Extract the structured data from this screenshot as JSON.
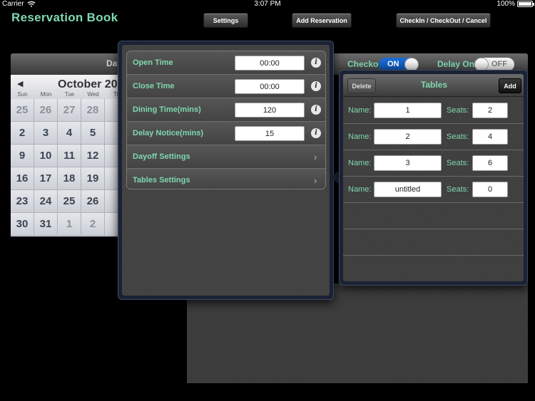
{
  "status_bar": {
    "carrier": "Carrier",
    "time": "3:07 PM",
    "battery": "100%",
    "battery_level": 1.0,
    "icons": [
      "wifi-icon",
      "battery-icon"
    ]
  },
  "nav": {
    "title": "Reservation Book",
    "settings_label": "Settings",
    "add_reservation_label": "Add Reservation",
    "checkin_label": "CheckIn / CheckOut / Cancel"
  },
  "header": {
    "date_label": "Date:",
    "checkout_label": "Checkout",
    "checkout_toggle": "ON",
    "delay_label": "Delay Only",
    "delay_toggle": "OFF"
  },
  "calendar": {
    "prev_icon": "◀",
    "month_label": "October 20",
    "weekdays": [
      "Sun",
      "Mon",
      "Tue",
      "Wed",
      "Th"
    ],
    "weeks": [
      [
        {
          "d": "25",
          "dim": true
        },
        {
          "d": "26",
          "dim": true
        },
        {
          "d": "27",
          "dim": true
        },
        {
          "d": "28",
          "dim": true
        },
        {
          "d": "",
          "dim": true
        }
      ],
      [
        {
          "d": "2"
        },
        {
          "d": "3"
        },
        {
          "d": "4"
        },
        {
          "d": "5"
        },
        {
          "d": ""
        }
      ],
      [
        {
          "d": "9"
        },
        {
          "d": "10"
        },
        {
          "d": "11"
        },
        {
          "d": "12"
        },
        {
          "d": ""
        }
      ],
      [
        {
          "d": "16"
        },
        {
          "d": "17"
        },
        {
          "d": "18"
        },
        {
          "d": "19"
        },
        {
          "d": ""
        }
      ],
      [
        {
          "d": "23"
        },
        {
          "d": "24"
        },
        {
          "d": "25"
        },
        {
          "d": "26"
        },
        {
          "d": ""
        }
      ],
      [
        {
          "d": "30"
        },
        {
          "d": "31"
        },
        {
          "d": "1",
          "dim": true
        },
        {
          "d": "2",
          "dim": true
        },
        {
          "d": ""
        }
      ]
    ]
  },
  "settings": {
    "rows": [
      {
        "label": "Open Time",
        "value": "00:00",
        "icon": "info-icon"
      },
      {
        "label": "Close Time",
        "value": "00:00",
        "icon": "info-icon"
      },
      {
        "label": "Dining Time(mins)",
        "value": "120",
        "icon": "info-icon"
      },
      {
        "label": "Delay Notice(mins)",
        "value": "15",
        "icon": "info-icon"
      },
      {
        "label": "Dayoff Settings",
        "icon": "chevron-right-icon"
      },
      {
        "label": "Tables Settings",
        "icon": "chevron-right-icon"
      }
    ]
  },
  "tables": {
    "title": "Tables",
    "delete_label": "Delete",
    "add_label": "Add",
    "name_label": "Name:",
    "seats_label": "Seats:",
    "rows": [
      {
        "name": "1",
        "seats": "2"
      },
      {
        "name": "2",
        "seats": "4"
      },
      {
        "name": "3",
        "seats": "6"
      },
      {
        "name": "untitled",
        "seats": "0"
      }
    ]
  },
  "colors": {
    "accent_green": "#7fd8b0",
    "toggle_on": "#1e6fd8"
  }
}
